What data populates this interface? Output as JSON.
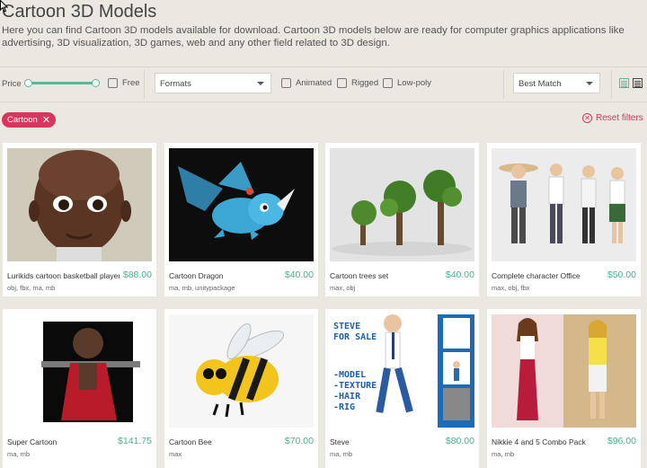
{
  "page": {
    "title": "Cartoon 3D Models",
    "description": "Here you can find Cartoon 3D models available for download. Cartoon 3D models below are ready for computer graphics applications like advertising, 3D visualization, 3D games, web and any other field related to 3D design."
  },
  "filters": {
    "price_label": "Price",
    "price_range": [
      0,
      1
    ],
    "free_label": "Free",
    "formats_label": "Formats",
    "animated_label": "Animated",
    "rigged_label": "Rigged",
    "lowpoly_label": "Low-poly",
    "sort_label": "Best Match",
    "view_mode": "grid"
  },
  "active_tags": [
    {
      "label": "Cartoon"
    }
  ],
  "reset_label": "Reset filters",
  "colors": {
    "accent": "#5cb89c",
    "price": "#4fae92",
    "tag": "#d8365e",
    "background": "#ebe7e1"
  },
  "products": [
    {
      "name": "Lurikids cartoon basketball player",
      "price": "$88.00",
      "formats": "obj, fbx, ma, mb"
    },
    {
      "name": "Cartoon Dragon",
      "price": "$40.00",
      "formats": "ma, mb, unitypackage"
    },
    {
      "name": "Cartoon trees set",
      "price": "$40.00",
      "formats": "max, obj"
    },
    {
      "name": "Complete character Office",
      "price": "$50.00",
      "formats": "max, obj, fbx"
    },
    {
      "name": "Super Cartoon",
      "price": "$141.75",
      "formats": "ma, mb"
    },
    {
      "name": "Cartoon Bee",
      "price": "$70.00",
      "formats": "max"
    },
    {
      "name": "Steve",
      "price": "$80.00",
      "formats": "ma, mb",
      "thumb_text": [
        "STEVE",
        "FOR SALE",
        "-MODEL",
        "-TEXTURE",
        "-HAIR",
        "-RIG"
      ]
    },
    {
      "name": "Nikkie 4 and 5 Combo Pack",
      "price": "$96.00",
      "formats": "ma, mb"
    }
  ]
}
